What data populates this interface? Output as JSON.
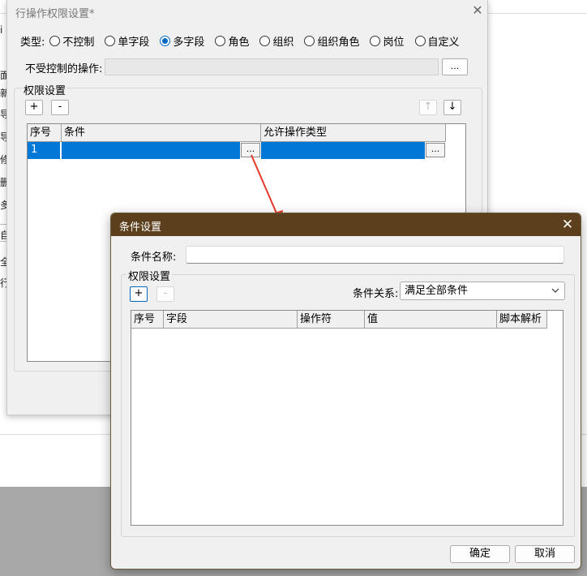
{
  "background": {
    "edge_chars": [
      "ⅰ",
      "面",
      "新",
      "导",
      "导",
      "修",
      "删",
      "多",
      "自",
      "全",
      "行"
    ]
  },
  "main_dialog": {
    "title": "行操作权限设置*",
    "close_glyph": "✕",
    "type_label": "类型:",
    "type_options": [
      {
        "label": "不控制",
        "selected": false
      },
      {
        "label": "单字段",
        "selected": false
      },
      {
        "label": "多字段",
        "selected": true
      },
      {
        "label": "角色",
        "selected": false
      },
      {
        "label": "组织",
        "selected": false
      },
      {
        "label": "组织角色",
        "selected": false
      },
      {
        "label": "岗位",
        "selected": false
      },
      {
        "label": "自定义",
        "selected": false
      }
    ],
    "uncontrolled_label": "不受控制的操作:",
    "uncontrolled_value": "",
    "ellipsis_label": "...",
    "permission_group_title": "权限设置",
    "add_label": "+",
    "remove_label": "-",
    "move_up_label": "↑",
    "move_down_label": "↓",
    "grid": {
      "columns": [
        "序号",
        "条件",
        "允许操作类型"
      ],
      "rows": [
        {
          "index": "1",
          "condition": "",
          "allowed_ops": ""
        }
      ]
    }
  },
  "condition_dialog": {
    "title": "条件设置",
    "close_glyph": "✕",
    "name_label": "条件名称:",
    "name_value": "",
    "permission_group_title": "权限设置",
    "add_label": "+",
    "remove_label": "-",
    "relation_label": "条件关系:",
    "relation_value": "满足全部条件",
    "grid": {
      "columns": [
        "序号",
        "字段",
        "操作符",
        "值",
        "脚本解析"
      ],
      "rows": []
    },
    "ok_label": "确定",
    "cancel_label": "取消"
  },
  "colors": {
    "selection": "#0078d7",
    "dialog_titlebar": "#5c401e",
    "arrow": "#e8382a",
    "radio_selected": "#0067c0"
  }
}
